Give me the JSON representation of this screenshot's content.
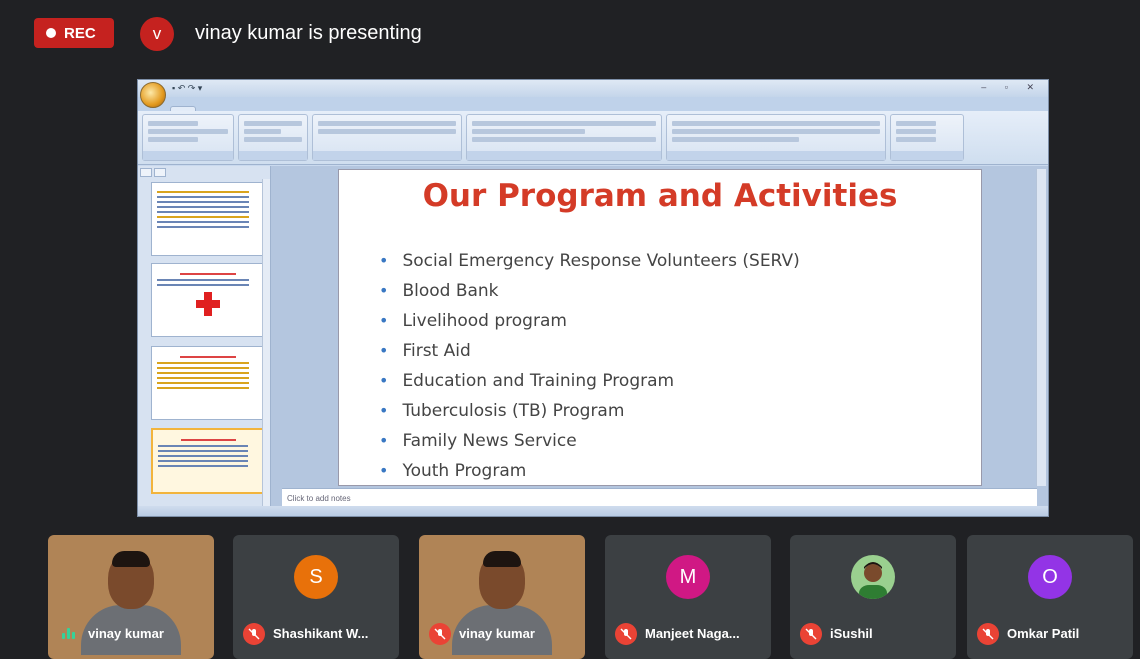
{
  "top_bar": {
    "rec_label": "REC",
    "presenter_initial": "v",
    "presenter_text": "vinay kumar is presenting",
    "accent": "#c5221f"
  },
  "slide": {
    "title": "Our Program and Activities",
    "bullets": [
      "Social Emergency Response Volunteers (SERV)",
      "Blood Bank",
      "Livelihood program",
      "First Aid",
      "Education and Training Program",
      "Tuberculosis (TB) Program",
      "Family News Service",
      "Youth Program"
    ],
    "notes_placeholder": "Click to add notes",
    "title_color": "#d43b27"
  },
  "participants": [
    {
      "name": "vinay kumar",
      "type": "video",
      "muted": false
    },
    {
      "name": "Shashikant W...",
      "initial": "S",
      "color": "#e8710a",
      "muted": true
    },
    {
      "name": "vinay kumar",
      "type": "video",
      "muted": true
    },
    {
      "name": "Manjeet Naga...",
      "initial": "M",
      "color": "#d01884",
      "muted": true
    },
    {
      "name": "iSushil",
      "type": "photo",
      "muted": true
    },
    {
      "name": "Omkar Patil",
      "initial": "O",
      "color": "#9334e6",
      "muted": true
    }
  ]
}
